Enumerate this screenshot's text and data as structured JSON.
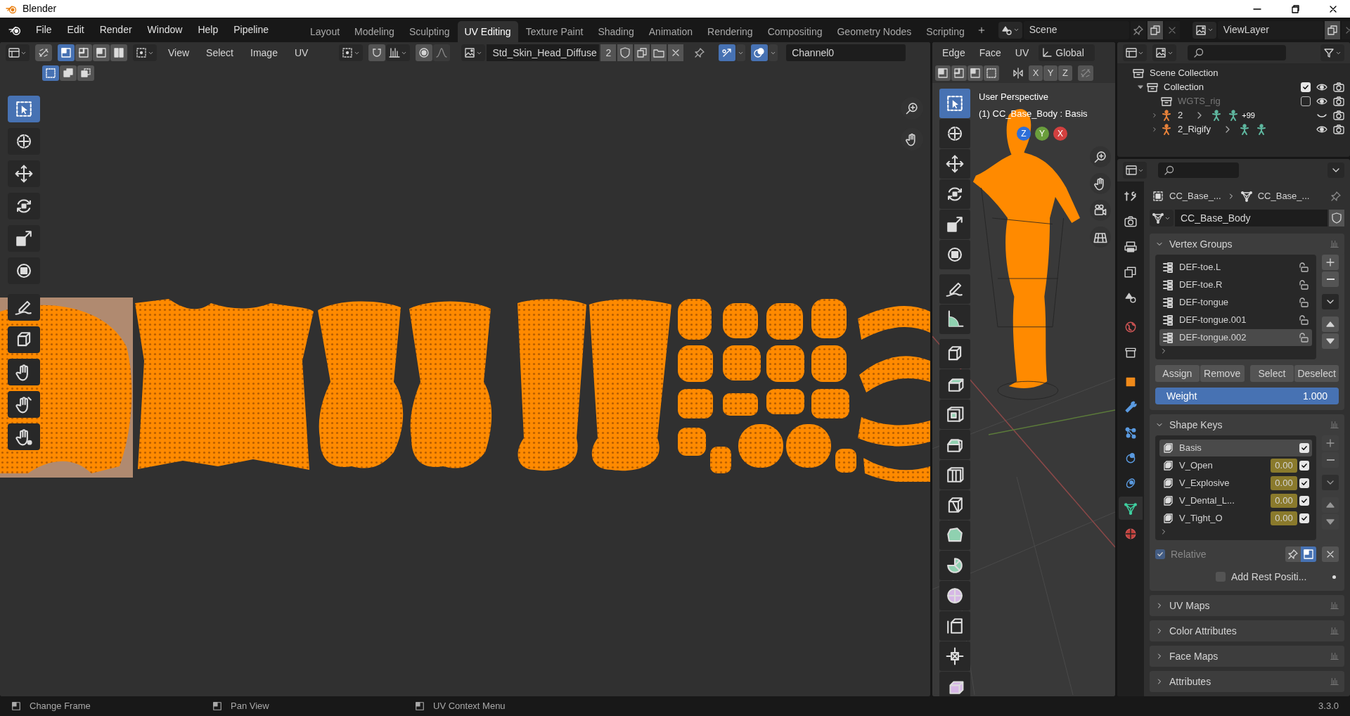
{
  "window": {
    "title": "Blender"
  },
  "menu": [
    "File",
    "Edit",
    "Render",
    "Window",
    "Help",
    "Pipeline"
  ],
  "workspaces": [
    {
      "label": "Layout",
      "selected": false
    },
    {
      "label": "Modeling",
      "selected": false
    },
    {
      "label": "Sculpting",
      "selected": false
    },
    {
      "label": "UV Editing",
      "selected": true
    },
    {
      "label": "Texture Paint",
      "selected": false
    },
    {
      "label": "Shading",
      "selected": false
    },
    {
      "label": "Animation",
      "selected": false
    },
    {
      "label": "Rendering",
      "selected": false
    },
    {
      "label": "Compositing",
      "selected": false
    },
    {
      "label": "Geometry Nodes",
      "selected": false
    },
    {
      "label": "Scripting",
      "selected": false
    }
  ],
  "scene": {
    "name": "Scene"
  },
  "view_layer": {
    "name": "ViewLayer"
  },
  "uv_editor": {
    "select_modes": [
      {
        "kind": "vertex",
        "selected": true
      },
      {
        "kind": "edge",
        "selected": false
      },
      {
        "kind": "face",
        "selected": false
      },
      {
        "kind": "island",
        "selected": false
      }
    ],
    "selection_ops": [
      {
        "kind": "new",
        "selected": true
      },
      {
        "kind": "extend",
        "selected": false
      },
      {
        "kind": "subtract",
        "selected": false
      }
    ],
    "menus": [
      "View",
      "Select",
      "Image",
      "UV"
    ],
    "image": "Std_Skin_Head_Diffuse",
    "users": "2",
    "uv_map": "Channel0"
  },
  "viewport": {
    "menus": [
      "Edge",
      "Face",
      "UV"
    ],
    "orientation": "Global",
    "mirror_axes": [
      "X",
      "Y",
      "Z"
    ],
    "info": [
      "User Perspective",
      "(1) CC_Base_Body : Basis"
    ],
    "gizmo_axes": [
      {
        "label": "Z",
        "color": "#2e6fd8"
      },
      {
        "label": "Y",
        "color": "#6a9e3c"
      },
      {
        "label": "X",
        "color": "#d2403f"
      }
    ]
  },
  "outliner": {
    "tree": [
      {
        "label": "Scene Collection",
        "kind": "scene_collection",
        "children": [
          {
            "label": "Collection",
            "kind": "collection",
            "expanded": true,
            "checked": true,
            "visible": true,
            "children": [
              {
                "label": "WGTS_rig",
                "kind": "collection",
                "checked": false,
                "visible": true
              },
              {
                "label": "2",
                "kind": "armature",
                "expanded": false,
                "visible": false,
                "badge": "+99"
              },
              {
                "label": "2_Rigify",
                "kind": "armature",
                "expanded": false,
                "visible": true
              }
            ]
          }
        ]
      }
    ]
  },
  "properties": {
    "tabs": [
      {
        "kind": "tool",
        "selected": false
      },
      {
        "kind": "render",
        "selected": false
      },
      {
        "kind": "output",
        "selected": false
      },
      {
        "kind": "view_layer",
        "selected": false
      },
      {
        "kind": "scene",
        "selected": false
      },
      {
        "kind": "world",
        "selected": false
      },
      {
        "kind": "collection",
        "selected": false
      },
      {
        "kind": "object",
        "selected": false
      },
      {
        "kind": "modifiers",
        "selected": false
      },
      {
        "kind": "particles",
        "selected": false
      },
      {
        "kind": "physics",
        "selected": false
      },
      {
        "kind": "constraints",
        "selected": false
      },
      {
        "kind": "data",
        "selected": true
      },
      {
        "kind": "material",
        "selected": false
      }
    ],
    "breadcrumb": [
      "CC_Base_...",
      "CC_Base_..."
    ],
    "data_name": "CC_Base_Body",
    "panels": [
      {
        "kind": "vertex_groups",
        "title": "Vertex Groups",
        "expanded": true,
        "items": [
          {
            "name": "DEF-toe.L",
            "selected": false
          },
          {
            "name": "DEF-toe.R",
            "selected": false
          },
          {
            "name": "DEF-tongue",
            "selected": false
          },
          {
            "name": "DEF-tongue.001",
            "selected": false
          },
          {
            "name": "DEF-tongue.002",
            "selected": true
          }
        ],
        "buttons": [
          "Assign",
          "Remove",
          "Select",
          "Deselect"
        ],
        "weight": {
          "label": "Weight",
          "value": "1.000",
          "level": 1
        }
      },
      {
        "kind": "shape_keys",
        "title": "Shape Keys",
        "expanded": true,
        "items": [
          {
            "name": "Basis",
            "selected": true,
            "checked": true
          },
          {
            "name": "V_Open",
            "value": "0.00",
            "selected": false,
            "checked": true
          },
          {
            "name": "V_Explosive",
            "value": "0.00",
            "selected": false,
            "checked": true
          },
          {
            "name": "V_Dental_L...",
            "value": "0.00",
            "selected": false,
            "checked": true
          },
          {
            "name": "V_Tight_O",
            "value": "0.00",
            "selected": false,
            "checked": true
          }
        ],
        "relative": {
          "label": "Relative",
          "checked": true
        },
        "add_rest": {
          "label": "Add Rest Positi...",
          "checked": false
        }
      },
      {
        "title": "UV Maps",
        "expanded": false
      },
      {
        "title": "Color Attributes",
        "expanded": false
      },
      {
        "title": "Face Maps",
        "expanded": false
      },
      {
        "title": "Attributes",
        "expanded": false
      }
    ]
  },
  "status_bar": {
    "hints": [
      "Change Frame",
      "Pan View",
      "UV Context Menu"
    ],
    "version": "3.3.0"
  }
}
